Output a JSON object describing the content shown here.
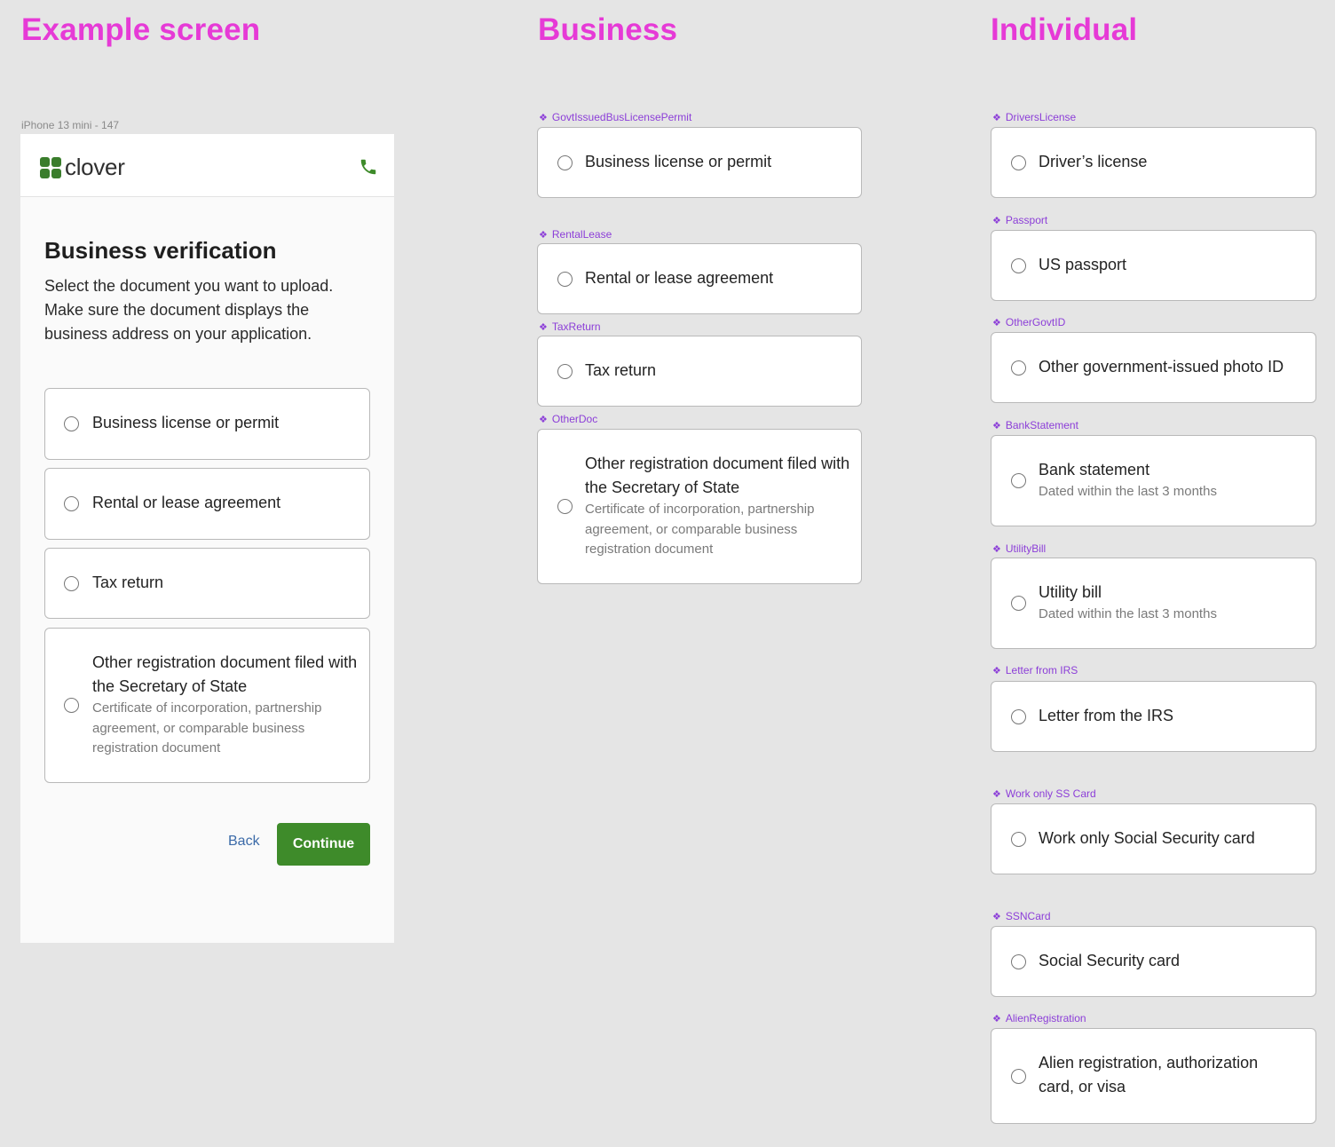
{
  "sections": {
    "example": "Example screen",
    "business": "Business",
    "individual": "Individual"
  },
  "frame_label": "iPhone 13 mini - 147",
  "phone": {
    "logo_text": "clover",
    "title": "Business verification",
    "description": "Select the document you want to upload. Make sure the document displays the business address on your application.",
    "options": [
      {
        "label": "Business license or permit"
      },
      {
        "label": "Rental or lease agreement"
      },
      {
        "label": "Tax return"
      },
      {
        "label": "Other registration document filed with the Secretary of State",
        "sub": "Certificate of incorporation, partnership agreement, or comparable business registration document"
      }
    ],
    "back_label": "Back",
    "continue_label": "Continue"
  },
  "business": [
    {
      "component": "GovtIssuedBusLicensePermit",
      "label": "Business license or permit"
    },
    {
      "component": "RentalLease",
      "label": "Rental or lease agreement"
    },
    {
      "component": "TaxReturn",
      "label": "Tax return"
    },
    {
      "component": "OtherDoc",
      "label": "Other registration document filed with the Secretary of State",
      "sub": "Certificate of incorporation, partnership agreement, or comparable business registration document"
    }
  ],
  "individual": [
    {
      "component": "DriversLicense",
      "label": "Driver’s license"
    },
    {
      "component": "Passport",
      "label": "US passport"
    },
    {
      "component": "OtherGovtID",
      "label": "Other government-issued photo ID"
    },
    {
      "component": "BankStatement",
      "label": "Bank statement",
      "sub": "Dated within the last 3 months"
    },
    {
      "component": "UtilityBill",
      "label": "Utility bill",
      "sub": "Dated within the last 3 months"
    },
    {
      "component": "Letter from IRS",
      "label": "Letter from the IRS"
    },
    {
      "component": "Work only SS Card",
      "label": "Work only Social Security card"
    },
    {
      "component": "SSNCard",
      "label": "Social Security card"
    },
    {
      "component": "AlienRegistration",
      "label": "Alien registration, authorization card, or visa"
    }
  ],
  "colors": {
    "section_title": "#e63ad6",
    "component_label": "#8c3ed8",
    "brand_green": "#3e8b2a",
    "back_link": "#3b6aa8"
  },
  "icons": {
    "logo": "clover-logo-icon",
    "phone": "phone-icon",
    "component": "component-diamond-icon",
    "radio": "radio-icon"
  }
}
